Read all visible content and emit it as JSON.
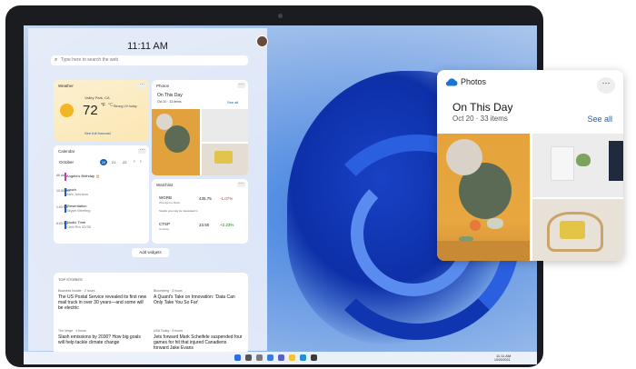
{
  "widgets": {
    "time": "11:11 AM",
    "search_placeholder": "Type here to search the web",
    "weather": {
      "title": "Weather",
      "location": "Valley Park, CA",
      "temp": "72",
      "unit_f": "°F",
      "unit_c": "°C",
      "uv": "Strong UV today",
      "forecast_link": "See full forecast"
    },
    "calendar": {
      "title": "Calendar",
      "month": "October",
      "days": [
        "20",
        "21",
        "22"
      ],
      "events": [
        {
          "time": "All day",
          "title": "Angela's Birthday 🎂",
          "sub": ""
        },
        {
          "time": "10:00 AM",
          "title": "Lunch",
          "sub": "Alex Johnson"
        },
        {
          "time": "1:00 PM",
          "title": "Presentation",
          "sub": "Skype Meeting"
        },
        {
          "time": "6:00 PM",
          "title": "Studio Time",
          "sub": "Conf Rm 32/35"
        }
      ]
    },
    "photos_small": {
      "title": "Photos",
      "subtitle": "On This Day",
      "meta": "Oct 20 · 33 items",
      "see_all": "See all"
    },
    "watchlist": {
      "title": "Watchlist",
      "stocks": [
        {
          "symbol": "WGRB",
          "name": "Woodgrove Bank",
          "price": "435.75",
          "change": "-1.07%"
        },
        {
          "symbol": "CTSP",
          "name": "Contoso",
          "price": "23.50",
          "change": "+2.23%"
        }
      ],
      "note": "Stocks you may be interested in"
    },
    "add_widgets": "Add widgets",
    "news": {
      "header": "TOP STORIES",
      "items": [
        {
          "source": "Business Insider · 2 hours",
          "headline": "The US Postal Service revealed its first new mail truck in over 30 years—and some will be electric"
        },
        {
          "source": "Bloomberg · 3 hours",
          "headline": "A Quant's Take on Innovation: 'Data Can Only Take You So Far'"
        },
        {
          "source": "The Verge · 4 hours",
          "headline": "Slash emissions by 2030? How big goals will help tackle climate change"
        },
        {
          "source": "USA Today · 5 hours",
          "headline": "Jets forward Mark Scheifele suspended four games for hit that injured Canadiens forward Jake Evans"
        }
      ]
    },
    "tray_time": "11:11 AM",
    "tray_date": "10/20/2021"
  },
  "photos_card": {
    "title": "Photos",
    "heading": "On This Day",
    "meta": "Oct 20 · 33 items",
    "see_all": "See all",
    "more": "···"
  },
  "colors": {
    "accent": "#1a5fb4",
    "wallpaper": "#1842c4",
    "negative": "#d13438",
    "positive": "#107c10"
  }
}
